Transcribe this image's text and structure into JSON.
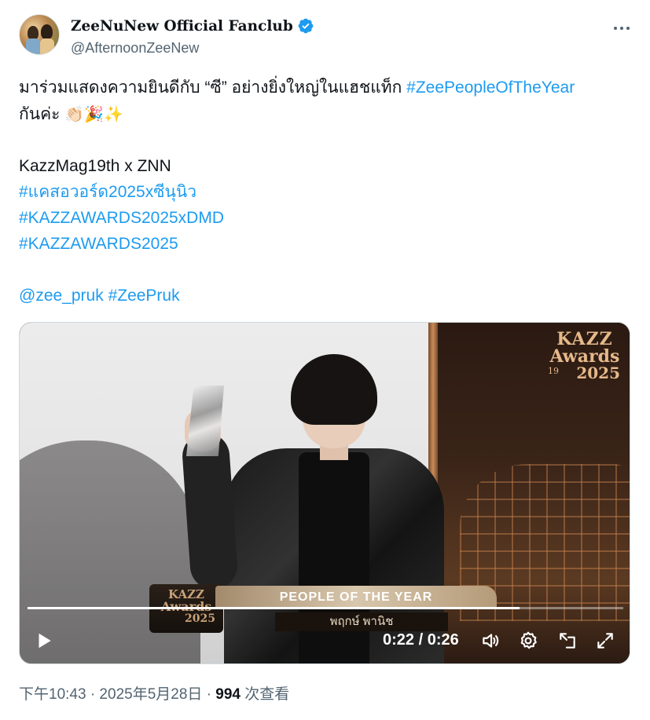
{
  "author": {
    "display_name": "ZeeNuNew Official Fanclub",
    "handle": "@AfternoonZeeNew",
    "verified": true
  },
  "tweet": {
    "line1_text": "มาร่วมแสดงความยินดีกับ “ซี” อย่างยิ่งใหญ่ในแฮชแท็ก ",
    "line1_hashtag": "#ZeePeopleOfTheYear",
    "line2_text": "กันค่ะ ",
    "line2_emojis": "👏🏻🎉✨",
    "line3": "KazzMag19th x ZNN",
    "hashtag1": "#แคสอวอร์ด2025xซีนุนิว",
    "hashtag2": "#KAZZAWARDS2025xDMD",
    "hashtag3": "#KAZZAWARDS2025",
    "mention": "@zee_pruk",
    "hashtag4": "#ZeePruk"
  },
  "video": {
    "logo_line1": "KAZZ",
    "logo_line2": "Awards",
    "logo_line3": "2025",
    "logo_anniv": "19",
    "lower_third_award": "PEOPLE OF THE YEAR",
    "lower_third_name": "พฤกษ์ พานิช",
    "time_current": "0:22",
    "time_separator": "/",
    "time_total": "0:26",
    "progress_fraction": 0.826
  },
  "meta": {
    "timestamp": "下午10:43 · 2025年5月28日 · ",
    "views_count": "994",
    "views_label": " 次查看"
  },
  "icons": {
    "more": "more-horizontal-icon",
    "verified": "verified-badge-icon",
    "play": "play-icon",
    "volume": "volume-icon",
    "settings": "gear-icon",
    "pip": "picture-in-picture-icon",
    "fullscreen": "fullscreen-icon"
  },
  "colors": {
    "link": "#1d9bf0",
    "text": "#0f1419",
    "secondary": "#536471"
  }
}
